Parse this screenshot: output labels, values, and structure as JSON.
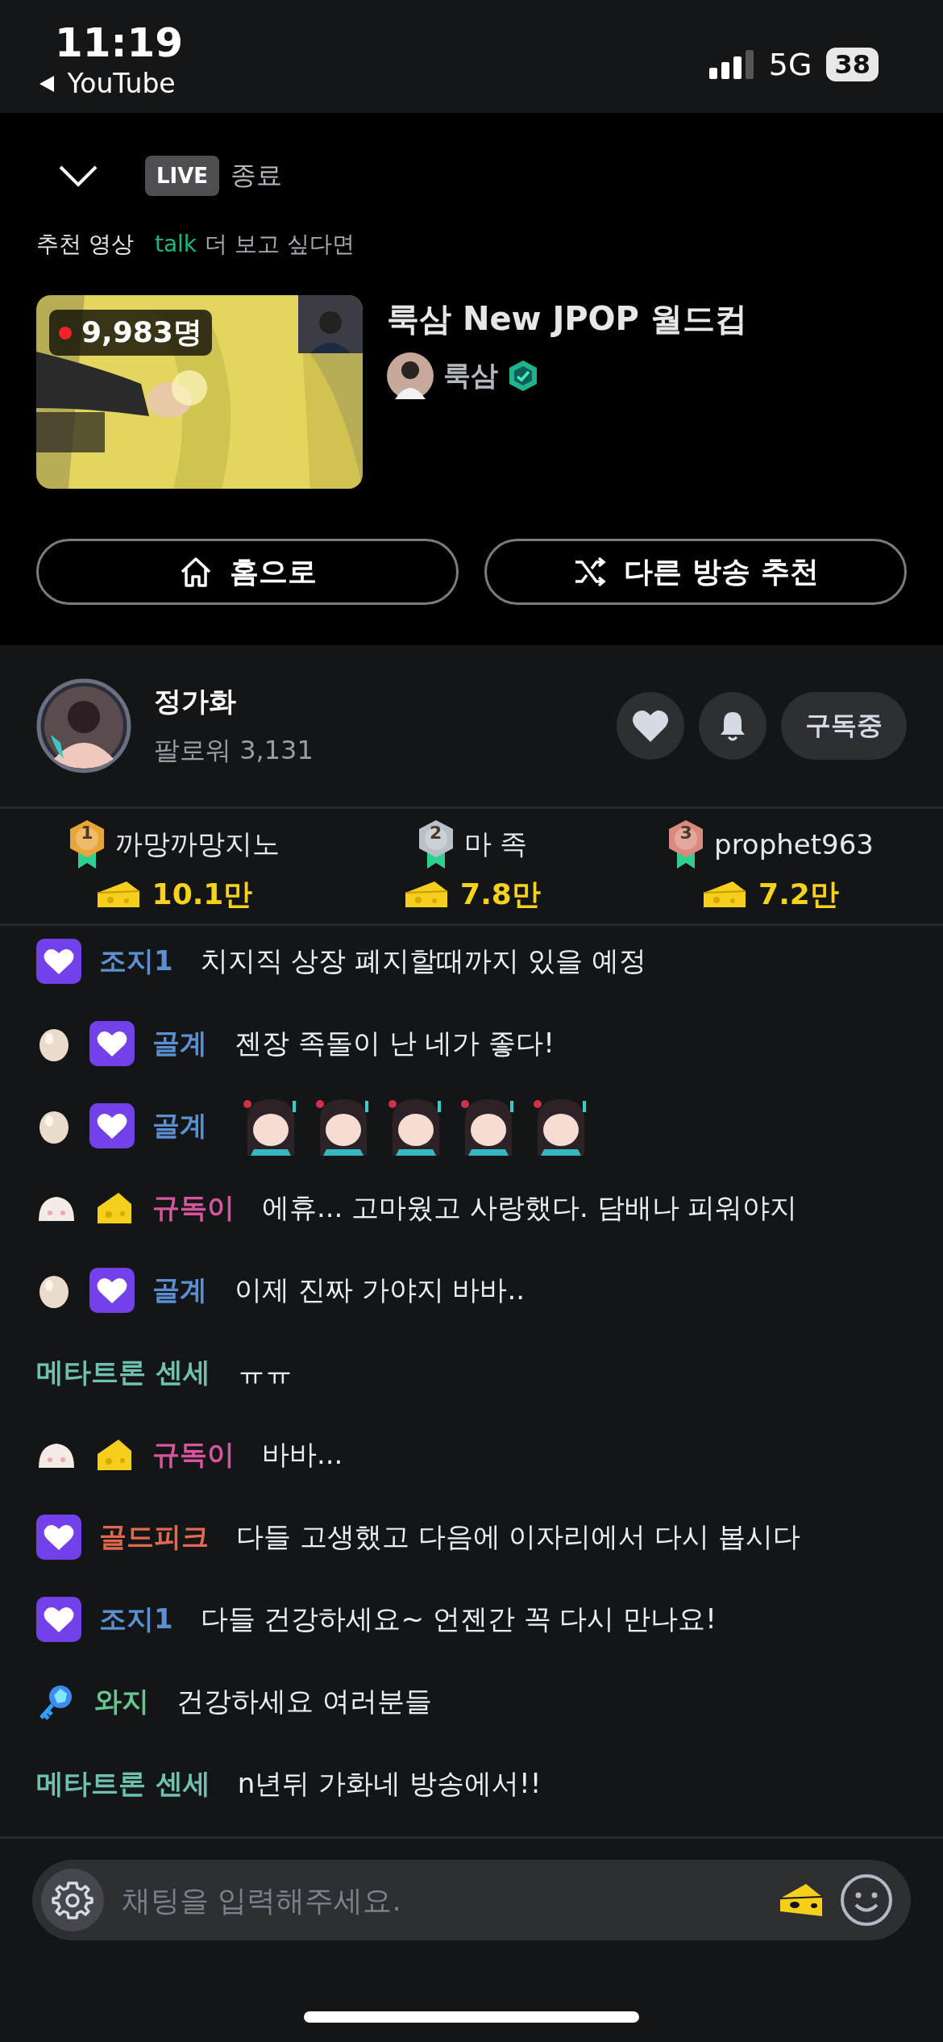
{
  "status_bar": {
    "time": "11:19",
    "back_label": "YouTube",
    "network": "5G",
    "battery": "38"
  },
  "header": {
    "live_badge": "LIVE",
    "live_status": "종료"
  },
  "recommend": {
    "label": "추천 영상",
    "brand": "talk",
    "hint": "더 보고 싶다면"
  },
  "video": {
    "thumbnail": {
      "kind": "picture"
    },
    "viewers": "9,983명",
    "title": "룩삼 New JPOP 월드컵",
    "channel": "룩삼",
    "verified": true
  },
  "actions": [
    {
      "kind": "home",
      "label": "홈으로"
    },
    {
      "kind": "shuffle",
      "label": "다른 방송 추천"
    }
  ],
  "streamer": {
    "name": "정가화",
    "followers": "팔로워 3,131",
    "liked": false,
    "subscribe_label": "구독중"
  },
  "ranking": [
    {
      "rank": "1",
      "name": "까망까망지노",
      "amount": "10.1만"
    },
    {
      "rank": "2",
      "name": "마 족",
      "amount": "7.8만"
    },
    {
      "rank": "3",
      "name": "prophet963",
      "amount": "7.2만"
    }
  ],
  "chat": [
    {
      "badges": [
        {
          "kind": "sub"
        }
      ],
      "name": "조지1",
      "color": "#5b8fd0",
      "text": "치지직 상장 폐지할때까지 있을 예정"
    },
    {
      "badges": [
        {
          "kind": "egg"
        },
        {
          "kind": "sub"
        }
      ],
      "name": "골계",
      "color": "#5b8fd0",
      "text": "젠장 족돌이 난 네가 좋다!"
    },
    {
      "badges": [
        {
          "kind": "egg"
        },
        {
          "kind": "sub"
        }
      ],
      "name": "골계",
      "color": "#5b8fd0",
      "emotes": [
        {
          "kind": "picture"
        },
        {
          "kind": "picture"
        },
        {
          "kind": "picture"
        },
        {
          "kind": "picture"
        },
        {
          "kind": "picture"
        }
      ]
    },
    {
      "badges": [
        {
          "kind": "bun"
        },
        {
          "kind": "cheese"
        }
      ],
      "name": "규독이",
      "color": "#d4569c",
      "text": "에휴... 고마웠고 사랑했다. 담배나 피워야지"
    },
    {
      "badges": [
        {
          "kind": "egg"
        },
        {
          "kind": "sub"
        }
      ],
      "name": "골계",
      "color": "#5b8fd0",
      "text": "이제 진짜 가야지 바바.."
    },
    {
      "name": "메타트론 센세",
      "color": "#6ec2ad",
      "text": "ㅠㅠ"
    },
    {
      "badges": [
        {
          "kind": "bun"
        },
        {
          "kind": "cheese"
        }
      ],
      "name": "규독이",
      "color": "#d4569c",
      "text": "바바..."
    },
    {
      "badges": [
        {
          "kind": "sub"
        }
      ],
      "name": "골드피크",
      "color": "#e0694f",
      "text": "다들 고생했고 다음에 이자리에서 다시 봅시다"
    },
    {
      "badges": [
        {
          "kind": "sub"
        }
      ],
      "name": "조지1",
      "color": "#5b8fd0",
      "text": "다들 건강하세요~ 언젠간 꼭 다시 만나요!"
    },
    {
      "badges": [
        {
          "kind": "key"
        }
      ],
      "name": "와지",
      "color": "#6ac48e",
      "text": "건강하세요 여러분들"
    },
    {
      "name": "메타트론 센세",
      "color": "#6ec2ad",
      "text": "n년뒤 가화네 방송에서!!"
    }
  ],
  "input": {
    "placeholder": "채팅을 입력해주세요."
  }
}
